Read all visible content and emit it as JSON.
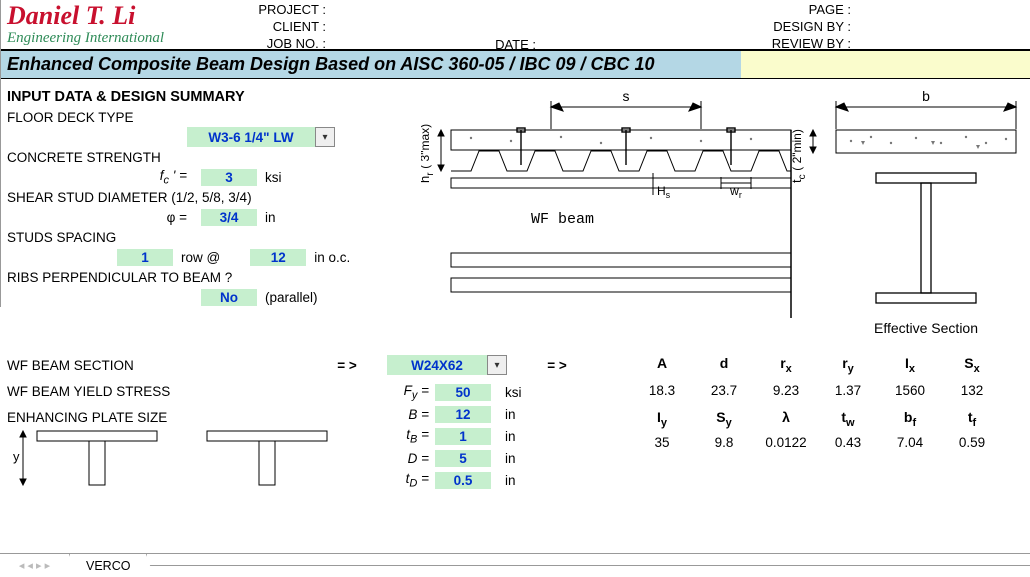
{
  "logo": {
    "name": "Daniel T. Li",
    "sub": "Engineering International"
  },
  "header": {
    "project": "PROJECT :",
    "client": "CLIENT :",
    "jobno": "JOB NO. :",
    "date": "DATE :",
    "page": "PAGE :",
    "design_by": "DESIGN BY :",
    "review_by": "REVIEW BY :"
  },
  "title": "Enhanced Composite Beam Design Based on AISC 360-05 / IBC 09 / CBC 10",
  "sec_heading": "INPUT DATA & DESIGN SUMMARY",
  "labels": {
    "floor_deck_type": "FLOOR DECK TYPE",
    "concrete_strength": "CONCRETE STRENGTH",
    "fc": "f",
    "fc_sub": "c",
    "fc_prime": " ' =",
    "fc_unit": "ksi",
    "stud_dia": "SHEAR STUD DIAMETER (1/2, 5/8, 3/4)",
    "phi": "φ  =",
    "phi_unit": "in",
    "stud_spacing": "STUDS SPACING",
    "row_at": "row @",
    "in_oc": "in o.c.",
    "ribs": "RIBS PERPENDICULAR TO BEAM ?",
    "parallel": "(parallel)",
    "wf_section": "WF BEAM SECTION",
    "arrow": "= >",
    "wf_yield": "WF BEAM YIELD STRESS",
    "Fy": "F",
    "Fy_sub": "y",
    "Fy_eq": " =",
    "Fy_unit": "ksi",
    "plate": "ENHANCING PLATE SIZE",
    "B": "B  =",
    "B_unit": "in",
    "tB": "t",
    "tB_sub": "B",
    "tB_eq": " =",
    "tB_unit": "in",
    "D": "D  =",
    "D_unit": "in",
    "tD": "t",
    "tD_sub": "D",
    "tD_eq": " =",
    "tD_unit": "in"
  },
  "values": {
    "deck_type": "W3-6 1/4\" LW",
    "fc": "3",
    "phi": "3/4",
    "stud_rows": "1",
    "stud_spacing": "12",
    "ribs_perp": "No",
    "wf_section": "W24X62",
    "Fy": "50",
    "B": "12",
    "tB": "1",
    "D": "5",
    "tD": "0.5"
  },
  "props": {
    "h1": [
      "A",
      "d",
      "r",
      "r",
      "I",
      "S"
    ],
    "h1_sub": [
      "",
      "",
      "x",
      "y",
      "x",
      "x"
    ],
    "r1": [
      "18.3",
      "23.7",
      "9.23",
      "1.37",
      "1560",
      "132"
    ],
    "h2": [
      "I",
      "S",
      "λ",
      "t",
      "b",
      "t"
    ],
    "h2_sub": [
      "y",
      "y",
      "",
      "w",
      "f",
      "f"
    ],
    "r2": [
      "35",
      "9.8",
      "0.0122",
      "0.43",
      "7.04",
      "0.59"
    ],
    "eff_section": "Effective  Section"
  },
  "diagram": {
    "s": "s",
    "b": "b",
    "hr": "h",
    "hr_sub": "r",
    "hr_note": "( 3\"max)",
    "tc": "t",
    "tc_sub": "c",
    "tc_note": "( 2\"min)",
    "Hs": "H",
    "Hs_sub": "s",
    "wr": "w",
    "wr_sub": "r",
    "wf_beam": "WF beam"
  },
  "tabs": {
    "verco": "VERCO"
  }
}
